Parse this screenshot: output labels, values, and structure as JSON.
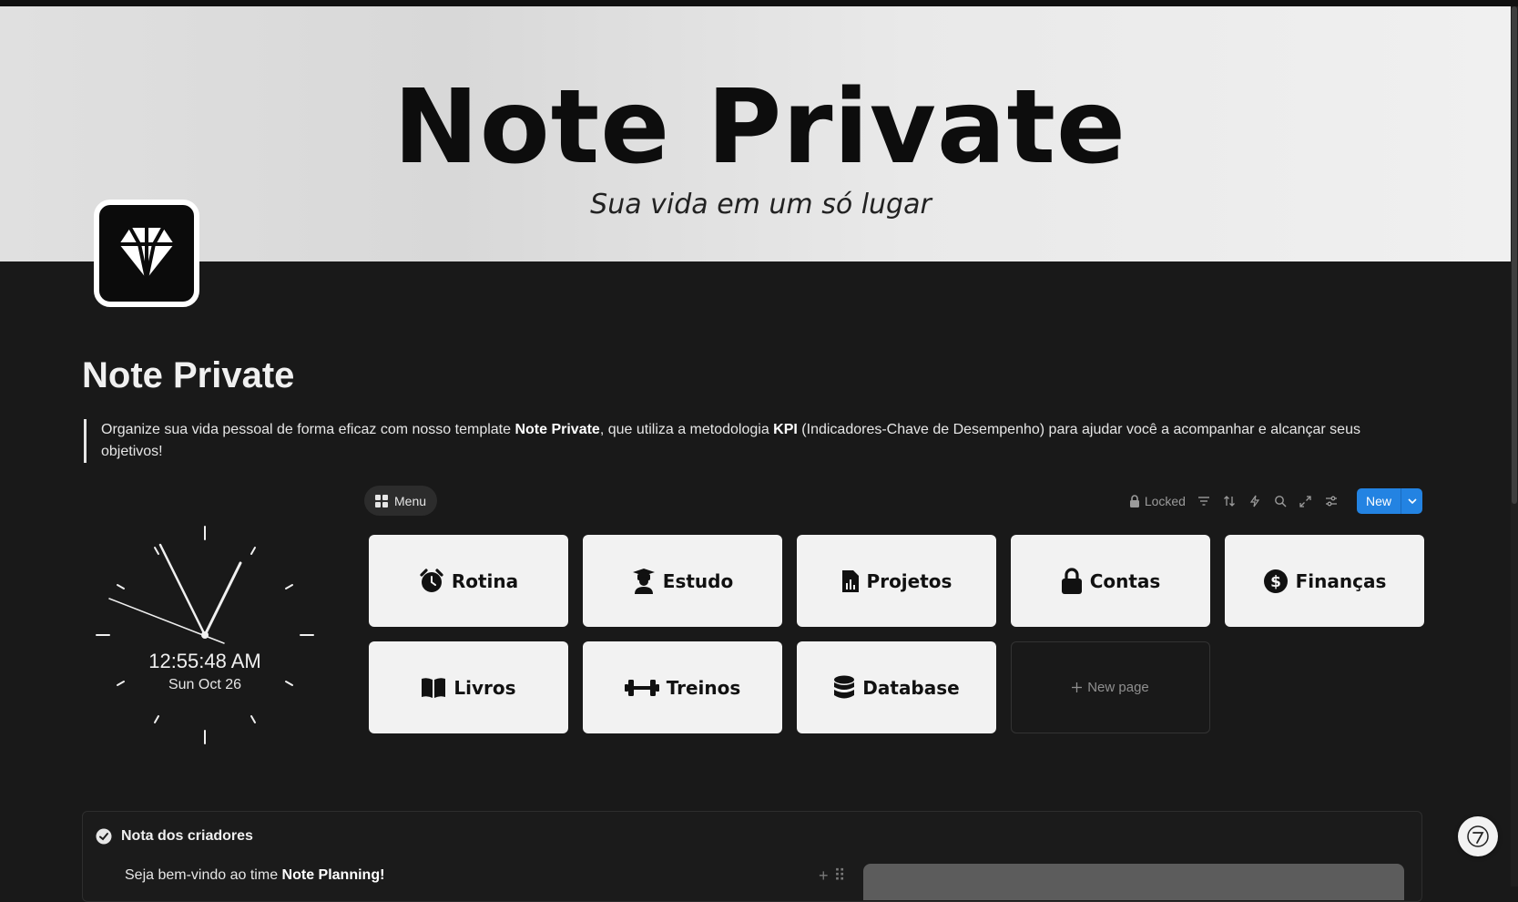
{
  "cover": {
    "title": "Note Private",
    "subtitle": "Sua vida em um só lugar"
  },
  "page": {
    "icon": "diamond-icon",
    "title": "Note Private",
    "quote_part1": "Organize sua vida pessoal de forma eficaz com nosso template ",
    "quote_bold1": "Note Private",
    "quote_part2": ", que utiliza a metodologia ",
    "quote_bold2": "KPI",
    "quote_part3": " (Indicadores-Chave de Desempenho) para ajudar você a acompanhar e alcançar seus objetivos!"
  },
  "clock": {
    "time": "12:55:48 AM",
    "date": "Sun Oct 26"
  },
  "gallery": {
    "view_label": "Menu",
    "locked_label": "Locked",
    "new_label": "New",
    "new_page_label": "New page",
    "cards": [
      {
        "label": "Rotina",
        "icon": "alarm-clock-icon"
      },
      {
        "label": "Estudo",
        "icon": "graduate-icon"
      },
      {
        "label": "Projetos",
        "icon": "report-file-icon"
      },
      {
        "label": "Contas",
        "icon": "lock-icon"
      },
      {
        "label": "Finanças",
        "icon": "dollar-circle-icon"
      },
      {
        "label": "Livros",
        "icon": "open-book-icon"
      },
      {
        "label": "Treinos",
        "icon": "dumbbell-icon"
      },
      {
        "label": "Database",
        "icon": "database-icon"
      }
    ]
  },
  "callout": {
    "title": "Nota dos criadores",
    "text_prefix": "Seja bem-vindo ao time ",
    "text_bold": "Note Planning!"
  },
  "colors": {
    "background": "#191919",
    "card": "#f2f2f2",
    "accent": "#2383e2"
  }
}
